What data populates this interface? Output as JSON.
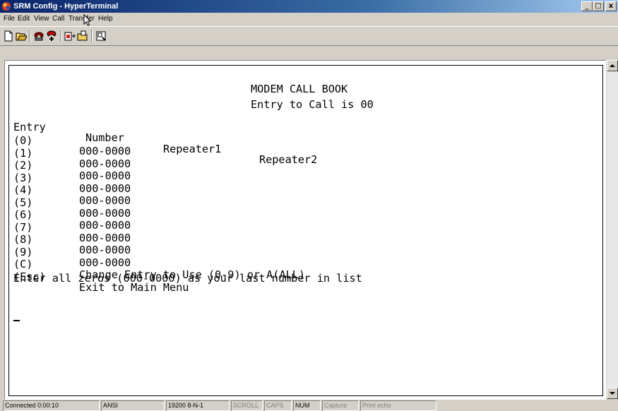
{
  "window": {
    "title": "SRM Config - HyperTerminal",
    "controls": {
      "minimize": "_",
      "maximize": "□",
      "close": "x"
    }
  },
  "menu": [
    "File",
    "Edit",
    "View",
    "Call",
    "Transfer",
    "Help"
  ],
  "toolbar": {
    "buttons": [
      "new-icon",
      "open-icon",
      "connect-icon",
      "disconnect-icon",
      "send-icon",
      "receive-icon",
      "properties-icon"
    ]
  },
  "terminal": {
    "heading": "MODEM CALL BOOK",
    "subheading": "Entry to Call is 00",
    "columns": {
      "entry": "Entry",
      "number": "Number",
      "repeater1": "Repeater1",
      "repeater2": "Repeater2"
    },
    "rows": [
      {
        "entry": "(0)",
        "number": "000-0000"
      },
      {
        "entry": "(1)",
        "number": "000-0000"
      },
      {
        "entry": "(2)",
        "number": "000-0000"
      },
      {
        "entry": "(3)",
        "number": "000-0000"
      },
      {
        "entry": "(4)",
        "number": "000-0000"
      },
      {
        "entry": "(5)",
        "number": "000-0000"
      },
      {
        "entry": "(6)",
        "number": "000-0000"
      },
      {
        "entry": "(7)",
        "number": "000-0000"
      },
      {
        "entry": "(8)",
        "number": "000-0000"
      },
      {
        "entry": "(9)",
        "number": "000-0000"
      }
    ],
    "options": [
      {
        "key": "(C)",
        "text": "Change Entry to Use (0-9) or A(ALL)"
      },
      {
        "key": "(Esc)",
        "text": "Exit to Main Menu"
      }
    ],
    "footer": "Enter all zeros (000-0000) as your last number in list",
    "cursor": "_"
  },
  "status": {
    "connected": "Connected 0:00:10",
    "emulation": "ANSI",
    "settings": "19200 8-N-1",
    "scroll": "SCROLL",
    "caps": "CAPS",
    "num": "NUM",
    "capture": "Capture",
    "print_echo": "Print echo"
  }
}
